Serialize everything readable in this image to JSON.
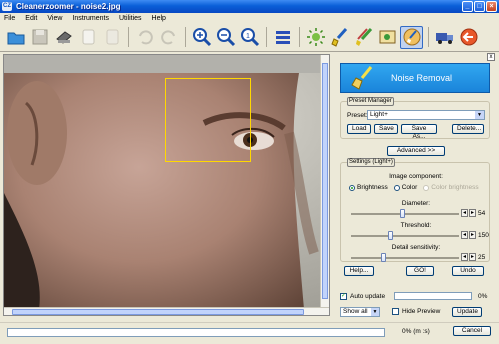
{
  "window": {
    "title": "Cleanerzoomer - noise2.jpg",
    "buttons": {
      "minimize": "_",
      "maximize": "□",
      "close": "×"
    }
  },
  "menu": [
    "File",
    "Edit",
    "View",
    "Instruments",
    "Utilities",
    "Help"
  ],
  "toolbar": {
    "buttons": [
      {
        "name": "open-folder-icon"
      },
      {
        "name": "save-icon"
      },
      {
        "name": "scanner-icon"
      },
      {
        "name": "copy-icon"
      },
      {
        "name": "paste-icon"
      },
      {
        "name": "undo-icon"
      },
      {
        "name": "redo-icon"
      },
      {
        "name": "zoom-in-icon"
      },
      {
        "name": "zoom-out-icon"
      },
      {
        "name": "zoom-actual-icon"
      },
      {
        "name": "layers-icon"
      },
      {
        "name": "brightness-icon"
      },
      {
        "name": "cleaner-brush-icon"
      },
      {
        "name": "multi-brush-icon"
      },
      {
        "name": "image-frame-icon"
      },
      {
        "name": "noise-removal-icon"
      },
      {
        "name": "batch-truck-icon"
      },
      {
        "name": "exit-arrow-icon"
      }
    ]
  },
  "panel": {
    "close": "x",
    "banner_title": "Noise Removal",
    "preset_manager": {
      "group_label": "Preset Manager",
      "preset_label": "Preset:",
      "preset_value": "Light+",
      "buttons": {
        "load": "Load",
        "save": "Save",
        "save_as": "Save As...",
        "delete": "Delete..."
      }
    },
    "advanced_button": "Advanced >>",
    "settings": {
      "group_label": "Settings (Light+)",
      "image_component_title": "Image component:",
      "radio": {
        "brightness": "Brightness",
        "color": "Color",
        "color_brightness": "Color brightness"
      },
      "sliders": [
        {
          "label": "Diameter:",
          "value": "54",
          "fraction": 0.47
        },
        {
          "label": "Threshold:",
          "value": "150",
          "fraction": 0.36
        },
        {
          "label": "Detail sensitivity:",
          "value": "25",
          "fraction": 0.3
        }
      ]
    },
    "buttons": {
      "help": "Help...",
      "go": "GO!",
      "undo": "Undo"
    },
    "auto_update": {
      "label": "Auto update",
      "progress": "0%"
    },
    "preview": {
      "show_select": "Show all",
      "hide_preview": "Hide Preview",
      "update": "Update"
    }
  },
  "status": {
    "progress_text": "0% (m :s)",
    "cancel": "Cancel"
  }
}
